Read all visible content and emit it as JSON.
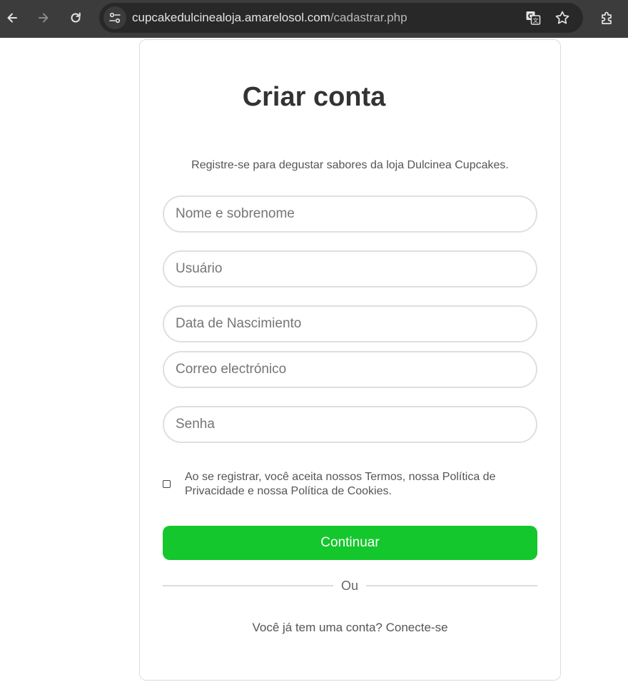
{
  "browser": {
    "url_host": "cupcakedulcinealoja.amarelosol.com",
    "url_path": "/cadastrar.php",
    "icons": [
      "back-arrow-icon",
      "forward-arrow-icon",
      "reload-icon",
      "site-info-icon",
      "translate-icon",
      "star-icon",
      "extensions-icon"
    ]
  },
  "form": {
    "title": "Criar conta",
    "subtitle": "Registre-se para degustar sabores da loja Dulcinea Cupcakes.",
    "fields": [
      {
        "placeholder": "Nome e sobrenome",
        "value": ""
      },
      {
        "placeholder": "Usuário",
        "value": ""
      },
      {
        "placeholder": "Data de Nascimiento",
        "value": ""
      },
      {
        "placeholder": "Correo electrónico",
        "value": ""
      },
      {
        "placeholder": "Senha",
        "value": ""
      }
    ],
    "terms_checked": false,
    "terms_text": "Ao se registrar, você aceita nossos Termos, nossa Política de Privacidade e nossa Política de Cookies.",
    "continue_label": "Continuar",
    "divider_label": "Ou",
    "login_prompt": "Você já tem uma conta?",
    "login_link": "Conecte-se"
  },
  "colors": {
    "toolbar_bg": "#3c3c3c",
    "omnibox_bg": "#282828",
    "accent_green": "#14c72c",
    "field_border": "#dfdfdf",
    "card_border": "#dcdcdc"
  }
}
